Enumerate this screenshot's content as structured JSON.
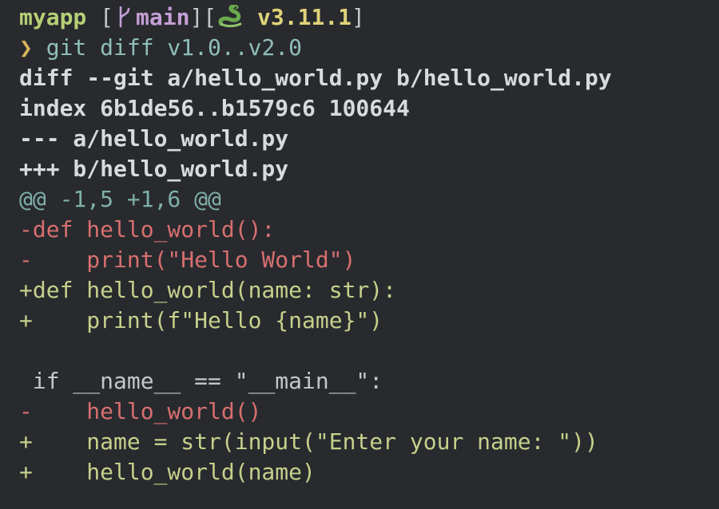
{
  "prompt": {
    "repo": "myapp",
    "open_bracket": "[",
    "branch": "main",
    "mid_brackets": "][",
    "python_version": "v3.11.1",
    "close_bracket": "]",
    "arrow": "❯",
    "command": "git diff v1.0..v2.0"
  },
  "diff_header": [
    "diff --git a/hello_world.py b/hello_world.py",
    "index 6b1de56..b1579c6 100644",
    "--- a/hello_world.py",
    "+++ b/hello_world.py"
  ],
  "hunk": "@@ -1,5 +1,6 @@",
  "lines": [
    {
      "type": "removed",
      "text": "-def hello_world():"
    },
    {
      "type": "removed",
      "text": "-    print(\"Hello World\")"
    },
    {
      "type": "added",
      "text": "+def hello_world(name: str):"
    },
    {
      "type": "added",
      "text": "+    print(f\"Hello {name}\")"
    },
    {
      "type": "context",
      "text": " "
    },
    {
      "type": "context",
      "text": " if __name__ == \"__main__\":"
    },
    {
      "type": "removed",
      "text": "-    hello_world()"
    },
    {
      "type": "added",
      "text": "+    name = str(input(\"Enter your name: \"))"
    },
    {
      "type": "added",
      "text": "+    hello_world(name)"
    }
  ],
  "colors": {
    "background": "#282a2e",
    "removed": "#d86f6f",
    "added": "#c5d18b",
    "hunk": "#7fb0a8"
  }
}
